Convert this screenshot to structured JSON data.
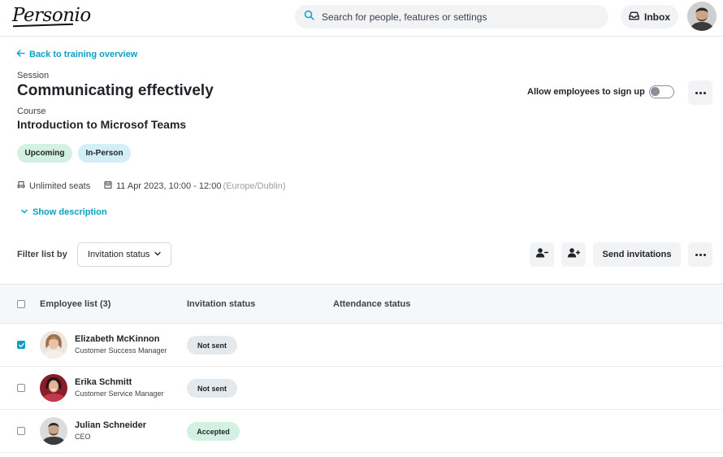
{
  "app": {
    "logo": "Personio"
  },
  "search": {
    "placeholder": "Search for people, features or settings"
  },
  "header": {
    "inbox_label": "Inbox"
  },
  "nav": {
    "back_label": "Back to training overview"
  },
  "session": {
    "label": "Session",
    "title": "Communicating effectively",
    "course_label": "Course",
    "course_title": "Introduction to Microsof Teams",
    "allow_signup_label": "Allow employees to sign up",
    "allow_signup_enabled": false,
    "badges": [
      {
        "label": "Upcoming",
        "color": "#d3f1e3"
      },
      {
        "label": "In-Person",
        "color": "#d4eef8"
      }
    ],
    "seats": "Unlimited seats",
    "datetime": "11 Apr 2023, 10:00 - 12:00",
    "timezone": "(Europe/Dublin)",
    "show_description": "Show description"
  },
  "toolbar": {
    "filter_label": "Filter list by",
    "filter_value": "Invitation status",
    "send_invitations": "Send invitations"
  },
  "table": {
    "columns": [
      "Employee list (3)",
      "Invitation status",
      "Attendance status"
    ],
    "rows": [
      {
        "name": "Elizabeth McKinnon",
        "role": "Customer Success Manager",
        "invitation_status": "Not sent",
        "status_color": "#e4e9ee",
        "checked": true
      },
      {
        "name": "Erika Schmitt",
        "role": "Customer Service Manager",
        "invitation_status": "Not sent",
        "status_color": "#e4e9ee",
        "checked": false
      },
      {
        "name": "Julian Schneider",
        "role": "CEO",
        "invitation_status": "Accepted",
        "status_color": "#d3f1e3",
        "checked": false
      }
    ]
  },
  "colors": {
    "accent": "#0b9fc1",
    "surface": "#f1f3f5"
  },
  "icons": [
    "search-icon",
    "inbox-icon",
    "arrow-left-icon",
    "seat-icon",
    "calendar-icon",
    "chevron-down-icon",
    "remove-user-icon",
    "add-user-icon",
    "more-icon",
    "check-icon"
  ]
}
